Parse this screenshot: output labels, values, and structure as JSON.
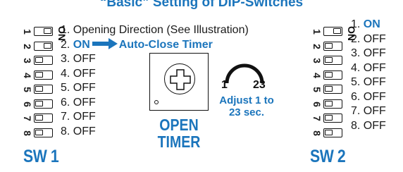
{
  "title": "“Basic” Setting of DIP-Switches",
  "sw1": {
    "label": "SW 1",
    "on_label": "ON",
    "numbers": [
      "1",
      "2",
      "3",
      "4",
      "5",
      "6",
      "7",
      "8"
    ],
    "settings": [
      {
        "num": "1.",
        "text": "Opening Direction (See Illustration)"
      },
      {
        "num": "2.",
        "value": "ON",
        "extra": "Auto-Close Timer"
      },
      {
        "num": "3.",
        "text": "OFF"
      },
      {
        "num": "4.",
        "text": "OFF"
      },
      {
        "num": "5.",
        "text": "OFF"
      },
      {
        "num": "6.",
        "text": "OFF"
      },
      {
        "num": "7.",
        "text": "OFF"
      },
      {
        "num": "8.",
        "text": "OFF"
      }
    ],
    "switch_states": [
      "on",
      "on",
      "off",
      "off",
      "off",
      "off",
      "off",
      "off"
    ]
  },
  "sw2": {
    "label": "SW 2",
    "on_label": "ON",
    "numbers": [
      "1",
      "2",
      "3",
      "4",
      "5",
      "6",
      "7",
      "8"
    ],
    "settings": [
      {
        "num": "1.",
        "value": "ON"
      },
      {
        "num": "2.",
        "text": "OFF"
      },
      {
        "num": "3.",
        "text": "OFF"
      },
      {
        "num": "4.",
        "text": "OFF"
      },
      {
        "num": "5.",
        "text": "OFF"
      },
      {
        "num": "6.",
        "text": "OFF"
      },
      {
        "num": "7.",
        "text": "OFF"
      },
      {
        "num": "8.",
        "text": "OFF"
      }
    ],
    "switch_states": [
      "on",
      "off",
      "off",
      "off",
      "off",
      "off",
      "off",
      "off"
    ]
  },
  "timer": {
    "label_line1": "OPEN",
    "label_line2": "TIMER",
    "range_min": "1",
    "range_max": "23",
    "adjust_line1": "Adjust 1 to",
    "adjust_line2": "23 sec."
  },
  "colors": {
    "accent": "#1b75bc",
    "text": "#1a1a1a"
  }
}
